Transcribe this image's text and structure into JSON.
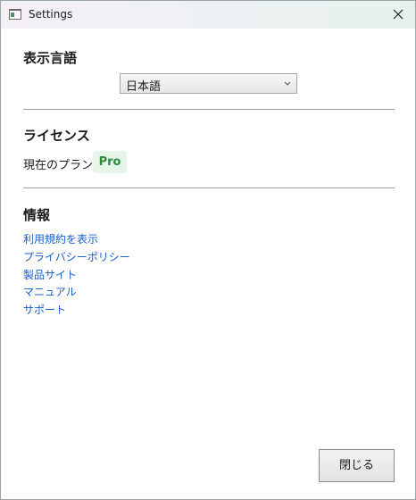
{
  "window": {
    "title": "Settings"
  },
  "language_section": {
    "heading": "表示言語",
    "selected_language": "日本語"
  },
  "license_section": {
    "heading": "ライセンス",
    "plan_label": "現在のプラン",
    "plan_value": "Pro"
  },
  "info_section": {
    "heading": "情報",
    "links": [
      "利用規約を表示",
      "プライバシーポリシー",
      "製品サイト",
      "マニュアル",
      "サポート"
    ]
  },
  "footer": {
    "close_label": "閉じる"
  },
  "colors": {
    "link": "#1a5fcf",
    "plan_badge_text": "#2e8b3a",
    "plan_badge_bg": "#e7f4ea"
  },
  "icons": {
    "app": "window-app-icon",
    "close": "close-icon",
    "dropdown": "chevron-down-icon"
  }
}
